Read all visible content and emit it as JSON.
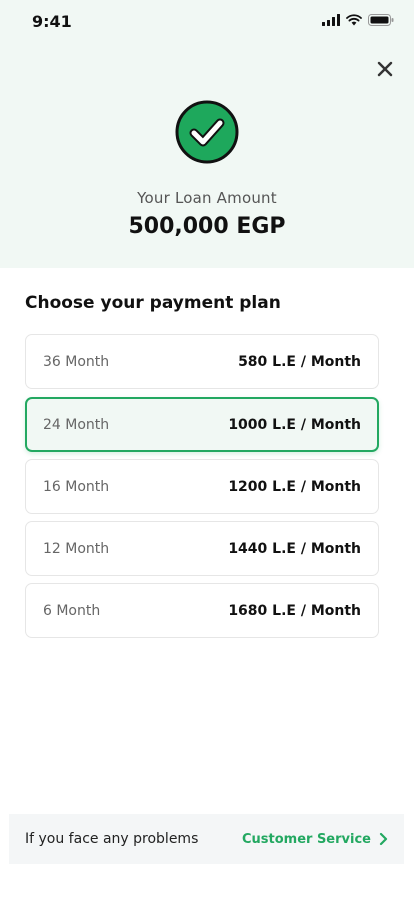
{
  "status_bar": {
    "time": "9:41"
  },
  "header": {
    "loan_label": "Your Loan Amount",
    "loan_amount": "500,000 EGP"
  },
  "plans": {
    "title": "Choose your payment plan",
    "selected_index": 1,
    "items": [
      {
        "months": "36 Month",
        "price": "580 L.E / Month"
      },
      {
        "months": "24 Month",
        "price": "1000 L.E / Month"
      },
      {
        "months": "16 Month",
        "price": "1200 L.E / Month"
      },
      {
        "months": "12 Month",
        "price": "1440 L.E / Month"
      },
      {
        "months": "6 Month",
        "price": "1680 L.E / Month"
      }
    ]
  },
  "footer": {
    "help_text": "If you face any problems",
    "customer_service": "Customer Service"
  },
  "colors": {
    "accent": "#23a861",
    "header_bg": "#f1f8f4",
    "check_fill": "#1ea85c"
  },
  "icons": {
    "close": "close-icon",
    "check": "check-circle-icon",
    "chevron": "chevron-right-icon",
    "signal": "cellular-signal-icon",
    "wifi": "wifi-icon",
    "battery": "battery-icon"
  }
}
